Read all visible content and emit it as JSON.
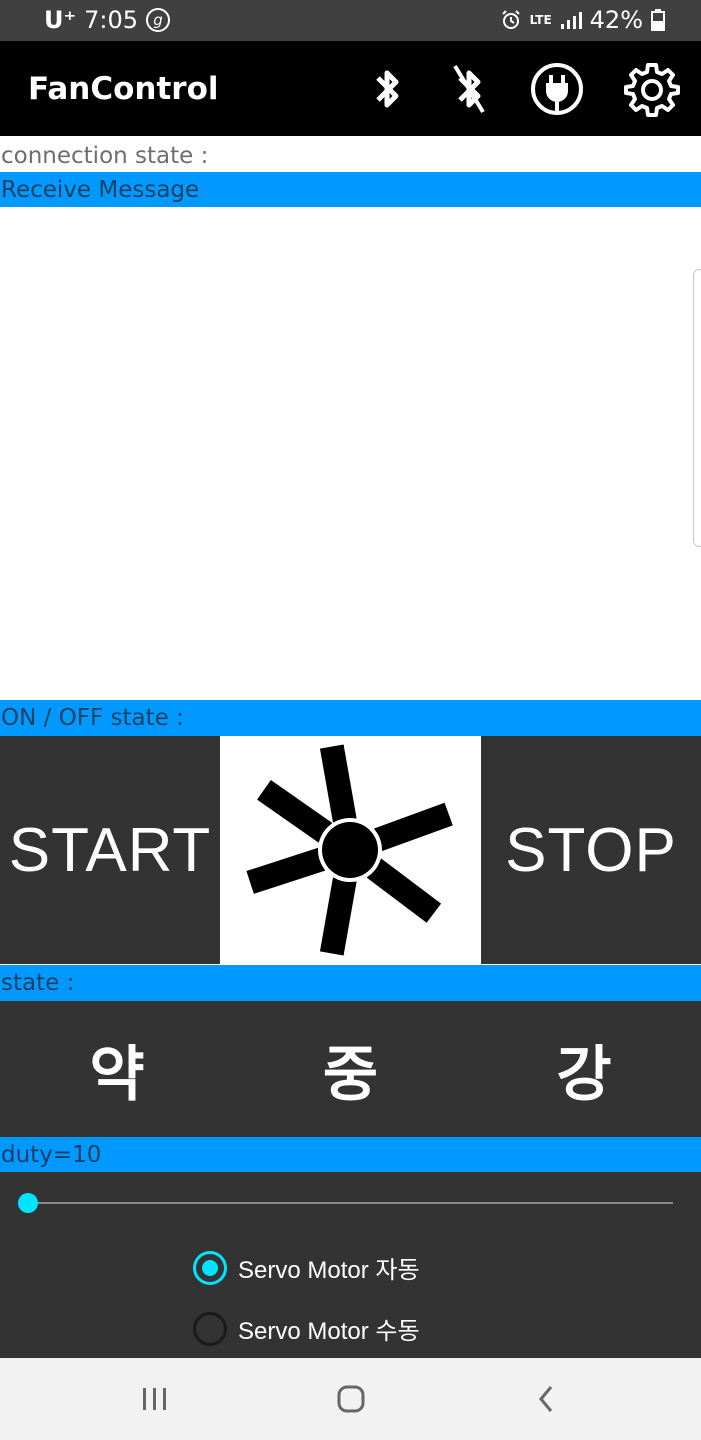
{
  "status_bar": {
    "carrier": "U⁺",
    "time": "7:05",
    "network": "LTE",
    "battery": "42%",
    "icons": [
      "g-icon",
      "alarm-icon",
      "signal-icon",
      "battery-icon"
    ]
  },
  "app_bar": {
    "title": "FanControl",
    "icons": [
      "bluetooth-icon",
      "bluetooth-disabled-icon",
      "power-plug-icon",
      "settings-gear-icon"
    ]
  },
  "labels": {
    "connection_state": "connection state :",
    "receive_message": "Receive Message",
    "on_off_state": "ON / OFF state :",
    "state": "state :",
    "duty": "duty=10"
  },
  "message_area": {
    "text": ""
  },
  "power_buttons": {
    "start": "START",
    "stop": "STOP"
  },
  "fan_image": {
    "icon": "fan-icon"
  },
  "speed_buttons": [
    "약",
    "중",
    "강"
  ],
  "slider": {
    "value": 10,
    "fill_fraction": 0.0,
    "accent": "#00e5ff"
  },
  "servo_options": [
    {
      "label": "Servo Motor 자동",
      "checked": true
    },
    {
      "label": "Servo Motor 수동",
      "checked": false
    }
  ],
  "nav_bar": {
    "icons": [
      "recent-apps-icon",
      "home-icon",
      "back-icon"
    ]
  },
  "colors": {
    "accent_blue": "#0099ff",
    "dark_panel": "#333333",
    "app_bar": "#000000"
  }
}
